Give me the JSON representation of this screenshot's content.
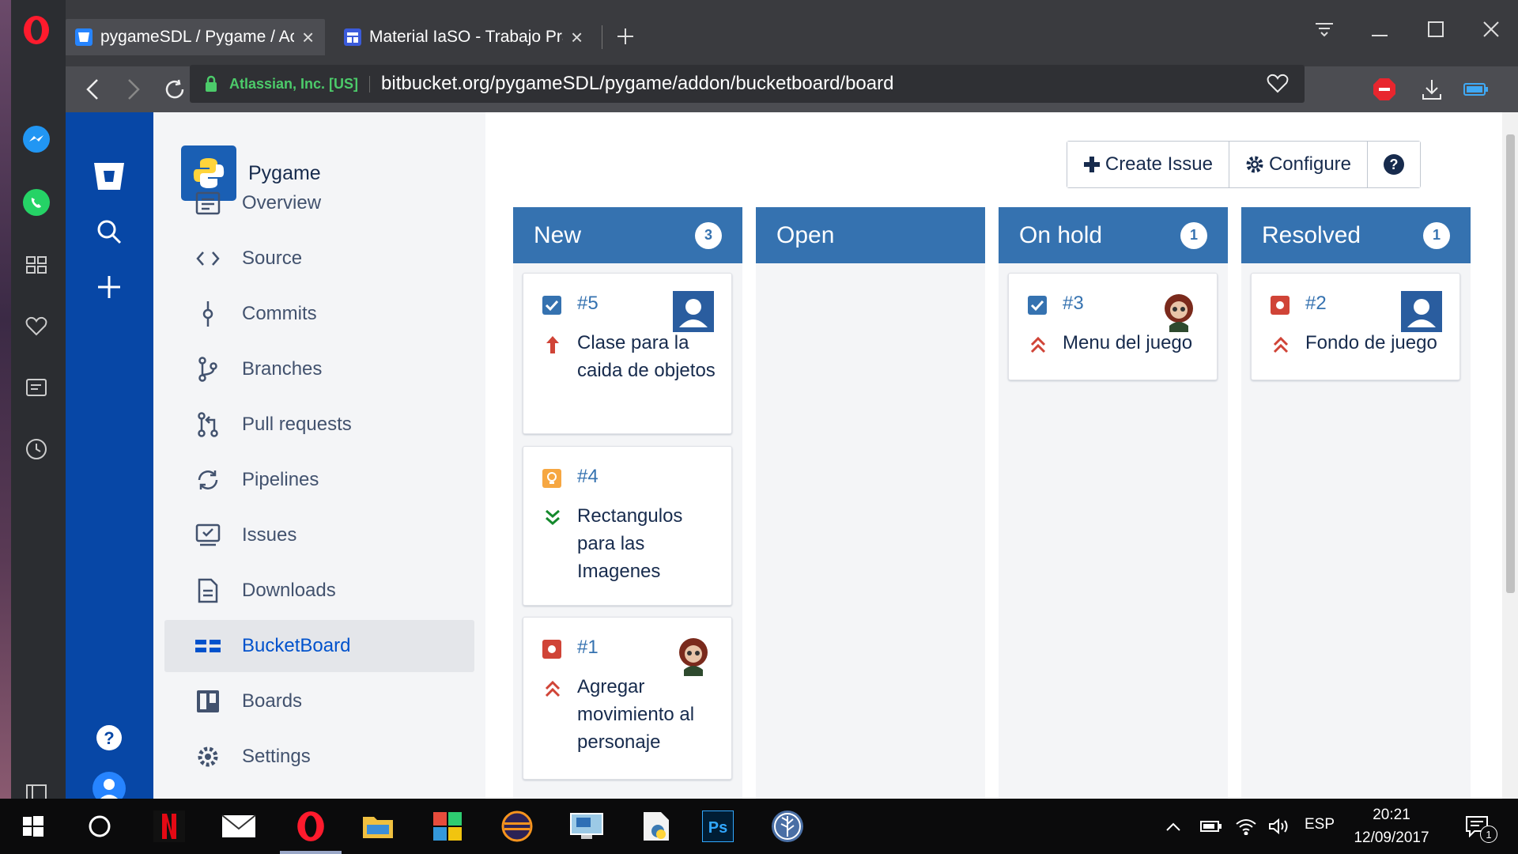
{
  "browser": {
    "tabs": [
      {
        "title": "pygameSDL / Pygame / Ac",
        "favicon": "bitbucket-icon",
        "active": true
      },
      {
        "title": "Material IaSO - Trabajo Prá",
        "favicon": "document-icon",
        "active": false
      }
    ],
    "address": {
      "cert_owner": "Atlassian, Inc. [US]",
      "url": "bitbucket.org/pygameSDL/pygame/addon/bucketboard/board"
    }
  },
  "sidebar": {
    "project_name": "Pygame",
    "items": [
      {
        "label": "Overview",
        "icon": "overview-icon"
      },
      {
        "label": "Source",
        "icon": "source-icon"
      },
      {
        "label": "Commits",
        "icon": "commits-icon"
      },
      {
        "label": "Branches",
        "icon": "branches-icon"
      },
      {
        "label": "Pull requests",
        "icon": "pull-requests-icon"
      },
      {
        "label": "Pipelines",
        "icon": "pipelines-icon"
      },
      {
        "label": "Issues",
        "icon": "issues-icon"
      },
      {
        "label": "Downloads",
        "icon": "downloads-icon"
      },
      {
        "label": "BucketBoard",
        "icon": "bucketboard-icon",
        "active": true
      },
      {
        "label": "Boards",
        "icon": "boards-icon"
      },
      {
        "label": "Settings",
        "icon": "settings-icon"
      }
    ]
  },
  "toolbar": {
    "create_label": "Create Issue",
    "configure_label": "Configure",
    "help_label": "?"
  },
  "board": {
    "columns": [
      {
        "title": "New",
        "count": "3"
      },
      {
        "title": "Open",
        "count": ""
      },
      {
        "title": "On hold",
        "count": "1"
      },
      {
        "title": "Resolved",
        "count": "1"
      }
    ],
    "cards": {
      "c5": {
        "id": "#5",
        "summary": "Clase para la caida de objetos",
        "type": "task",
        "priority": "major"
      },
      "c4": {
        "id": "#4",
        "summary": "Rectangulos para las Imagenes",
        "type": "enhancement",
        "priority": "trivial"
      },
      "c1": {
        "id": "#1",
        "summary": "Agregar movimiento al personaje",
        "type": "bug",
        "priority": "critical"
      },
      "c3": {
        "id": "#3",
        "summary": "Menu del juego",
        "type": "task",
        "priority": "critical"
      },
      "c2": {
        "id": "#2",
        "summary": "Fondo de juego",
        "type": "bug",
        "priority": "critical"
      }
    }
  },
  "taskbar": {
    "language": "ESP",
    "time": "20:21",
    "date": "12/09/2017",
    "notifications": "1"
  },
  "colors": {
    "bitbucket_blue": "#0747a6",
    "column_header": "#3572b0",
    "link": "#3572b0",
    "priority_red": "#d04437",
    "priority_green": "#14892c"
  }
}
